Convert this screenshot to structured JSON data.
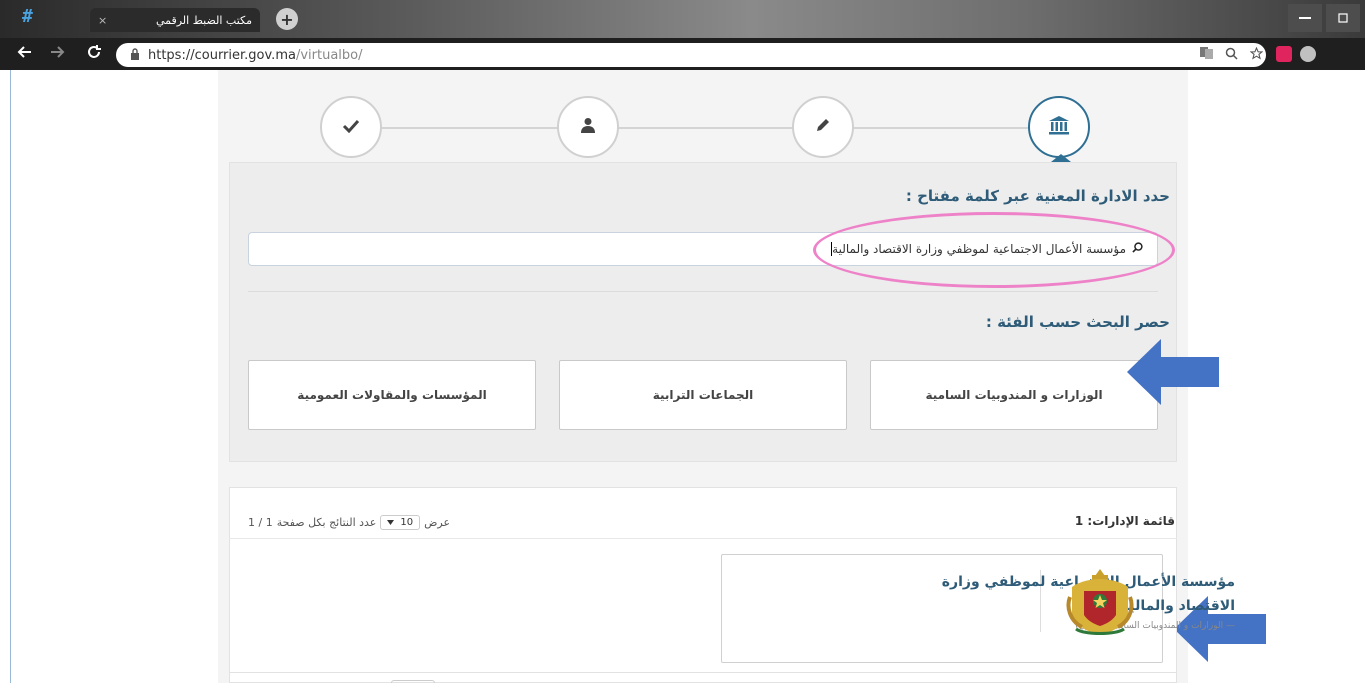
{
  "browser": {
    "tab_title": "مكتب الضبط الرقمي",
    "tab_close": "×",
    "new_tab": "+",
    "url_host": "https://courrier.gov.ma",
    "url_path": "/virtualbo/",
    "app_icon": "#"
  },
  "icons": {
    "back": "back-arrow-icon",
    "forward": "forward-arrow-icon",
    "reload": "reload-icon",
    "lock": "lock-icon",
    "translate": "translate-icon",
    "zoom": "zoom-icon",
    "star": "star-icon"
  },
  "stepper": {
    "steps": [
      "check-icon",
      "user-icon",
      "pencil-icon",
      "institution-icon"
    ],
    "active_step": 4
  },
  "search_section": {
    "label": "حدد الادارة المعنية عبر كلمة مفتاح :",
    "query": "مؤسسة الأعمال الاجتماعية لموظفي وزارة الاقتصاد والمالية"
  },
  "category_section": {
    "label": "حصر البحث حسب الفئة :",
    "categories": [
      "الوزارات و المندوبيات السامية",
      "الجماعات الترابية",
      "المؤسسات والمقاولات العمومية"
    ]
  },
  "results": {
    "list_label": "قائمة الإدارات: 1",
    "show_label": "عرض",
    "per_page_value": "10",
    "per_page_label": "عدد النتائج بكل صفحة",
    "page_info": "1 / 1",
    "items": [
      {
        "title": "مؤسسة الأعمال الاجتماعية لموظفي وزارة الاقتصاد والمالية",
        "subtitle": "— الوزارات و المندوبيات السامية (مركزي)"
      }
    ]
  },
  "colors": {
    "accent": "#2e6f93",
    "title_blue": "#2e5b78",
    "highlight": "#ee82c9",
    "arrow": "#4472c4"
  }
}
